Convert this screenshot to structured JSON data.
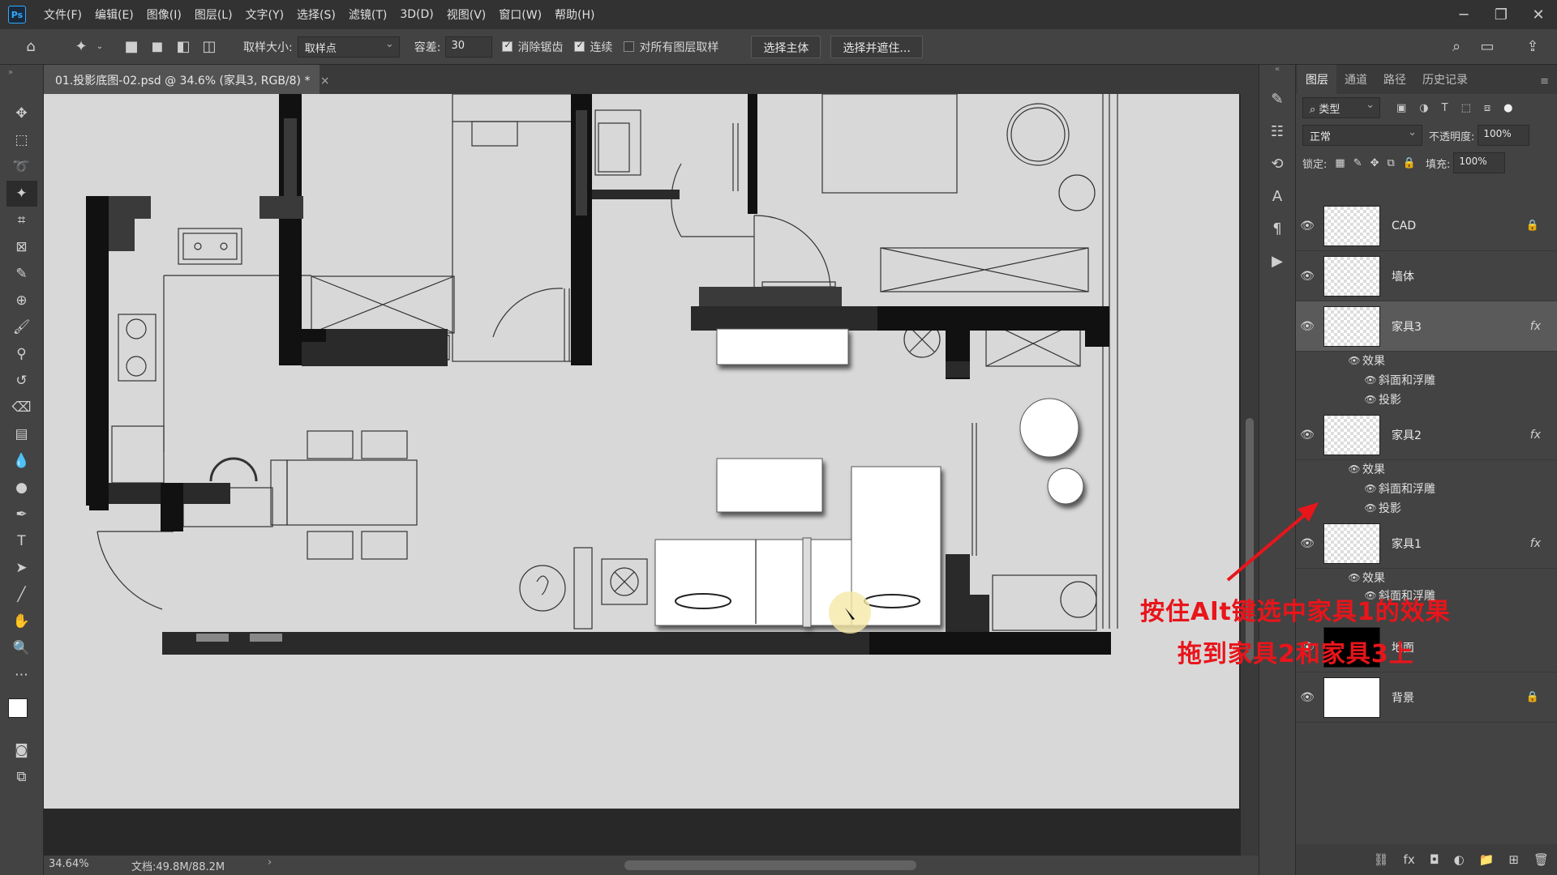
{
  "app": {
    "logo": "Ps"
  },
  "menu": [
    "文件(F)",
    "编辑(E)",
    "图像(I)",
    "图层(L)",
    "文字(Y)",
    "选择(S)",
    "滤镜(T)",
    "3D(D)",
    "视图(V)",
    "窗口(W)",
    "帮助(H)"
  ],
  "options": {
    "sample_size_label": "取样大小:",
    "sample_size_value": "取样点",
    "tolerance_label": "容差:",
    "tolerance_value": "30",
    "antialias_label": "消除锯齿",
    "contiguous_label": "连续",
    "all_layers_label": "对所有图层取样",
    "select_subject": "选择主体",
    "select_mask": "选择并遮住..."
  },
  "document": {
    "tab_title": "01.投影底图-02.psd @ 34.6% (家具3, RGB/8) *",
    "close": "×"
  },
  "status": {
    "zoom": "34.64%",
    "doc": "文档:49.8M/88.2M"
  },
  "panel": {
    "tabs": [
      "图层",
      "通道",
      "路径",
      "历史记录"
    ],
    "filter_label": "类型",
    "blend_mode": "正常",
    "opacity_label": "不透明度:",
    "opacity_value": "100%",
    "lock_label": "锁定:",
    "fill_label": "填充:",
    "fill_value": "100%",
    "layers": [
      {
        "name": "CAD",
        "locked": true,
        "fx": false
      },
      {
        "name": "墙体",
        "locked": false,
        "fx": false
      },
      {
        "name": "家具3",
        "locked": false,
        "fx": true,
        "selected": true
      },
      {
        "name": "家具2",
        "locked": false,
        "fx": true
      },
      {
        "name": "家具1",
        "locked": false,
        "fx": true
      },
      {
        "name": "地面",
        "locked": false,
        "fx": false
      },
      {
        "name": "背景",
        "locked": true,
        "fx": false
      }
    ],
    "effects_label": "效果",
    "bevel_label": "斜面和浮雕",
    "shadow_label": "投影",
    "fx_symbol": "fx"
  },
  "annotation": {
    "line1": "按住Alt键选中家具1的效果",
    "line2": "拖到家具2和家具3上"
  },
  "colors": {
    "annotation": "#e8151b",
    "accent": "#31a8ff"
  }
}
